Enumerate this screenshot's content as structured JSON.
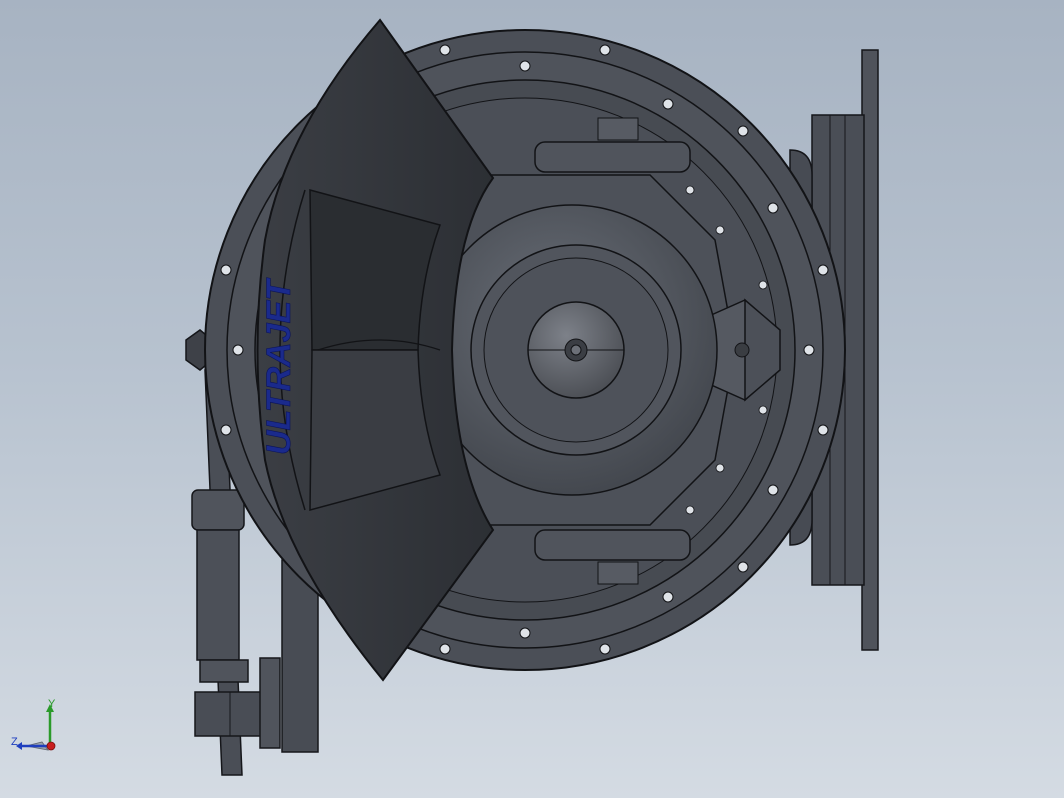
{
  "app": {
    "view": "cad-3d-viewport"
  },
  "model": {
    "brand_text": "ULTRAJET",
    "brand_color": "#1a2a8c",
    "body_color": "#4b4f57",
    "dark_color": "#34373d",
    "edge_color": "#121316"
  },
  "triad": {
    "y_label": "Y",
    "z_label": "Z",
    "y_color": "#2a9a2a",
    "z_color": "#1f3fbf",
    "x_color": "#c81e1e"
  },
  "colors": {
    "bg_top": "#a7b3c2",
    "bg_bottom": "#d4dbe3"
  }
}
